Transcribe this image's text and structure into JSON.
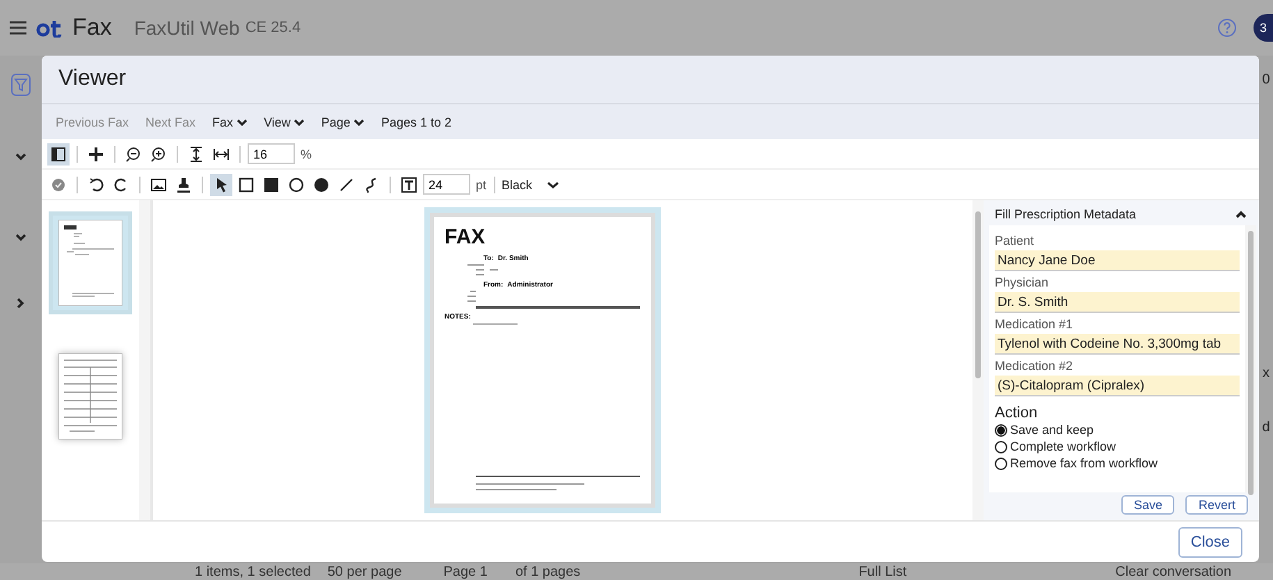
{
  "app": {
    "brand": "Fax",
    "title": "FaxUtil Web",
    "version": "CE 25.4",
    "avatar": "3",
    "edge_fragments": [
      "0",
      "x",
      "d"
    ],
    "status": {
      "count": "1 items, 1 selected",
      "per_page": "50 per page",
      "page": "Page 1",
      "of_pages": "of 1 pages",
      "list": "Full List",
      "clear": "Clear conversation"
    }
  },
  "viewer": {
    "title": "Viewer",
    "nav": [
      {
        "label": "Previous Fax",
        "kind": "link"
      },
      {
        "label": "Next Fax",
        "kind": "link"
      },
      {
        "label": "Fax",
        "kind": "menu"
      },
      {
        "label": "View",
        "kind": "menu"
      },
      {
        "label": "Page",
        "kind": "menu"
      },
      {
        "label": "Pages 1 to 2",
        "kind": "text"
      }
    ],
    "toolbar_view": [
      [
        {
          "kind": "panel",
          "selected": true
        }
      ],
      [
        {
          "kind": "plus",
          "selected": false
        }
      ],
      [
        {
          "kind": "zoom-out",
          "selected": false
        },
        {
          "kind": "zoom-in",
          "selected": false
        }
      ],
      [
        {
          "kind": "fit-height",
          "selected": false
        },
        {
          "kind": "fit-width",
          "selected": false
        }
      ]
    ],
    "zoom": {
      "value": "16",
      "unit": "%"
    },
    "toolbar_draw": [
      [
        {
          "kind": "approve",
          "selected": false
        }
      ],
      [
        {
          "kind": "undo",
          "selected": false
        },
        {
          "kind": "redo",
          "selected": false
        }
      ],
      [
        {
          "kind": "image",
          "selected": false
        },
        {
          "kind": "stamp",
          "selected": false
        }
      ],
      [
        {
          "kind": "pointer",
          "selected": true
        },
        {
          "kind": "rectangle",
          "selected": false
        },
        {
          "kind": "filled-rectangle",
          "selected": false
        },
        {
          "kind": "circle",
          "selected": false
        },
        {
          "kind": "filled-circle",
          "selected": false
        },
        {
          "kind": "line",
          "selected": false
        },
        {
          "kind": "squiggle",
          "selected": false
        }
      ],
      [
        {
          "kind": "text-box",
          "selected": false
        }
      ]
    ],
    "font_size": {
      "value": "24",
      "unit": "pt"
    },
    "line_color_label": "Black",
    "thumbnails": [
      {
        "kind": "cover",
        "selected": true
      },
      {
        "kind": "form",
        "selected": false
      }
    ],
    "page": {
      "heading": "FAX",
      "to_label": "To:",
      "to": "Dr. Smith",
      "from_label": "From:",
      "from": "Administrator",
      "notes_label": "NOTES:"
    },
    "metadata": {
      "title": "Fill Prescription Metadata",
      "expanded": true,
      "fields": [
        {
          "label": "Patient",
          "value": "Nancy Jane Doe"
        },
        {
          "label": "Physician",
          "value": "Dr. S. Smith"
        },
        {
          "label": "Medication #1",
          "value": "Tylenol with Codeine No. 3,300mg tab"
        },
        {
          "label": "Medication #2",
          "value": "(S)-Citalopram (Cipralex)"
        }
      ],
      "action_label": "Action",
      "actions": [
        {
          "label": "Save and keep",
          "selected": true
        },
        {
          "label": "Complete workflow",
          "selected": false
        },
        {
          "label": "Remove fax from workflow",
          "selected": false
        }
      ],
      "buttons": [
        "Save",
        "Revert"
      ]
    },
    "close": "Close"
  }
}
